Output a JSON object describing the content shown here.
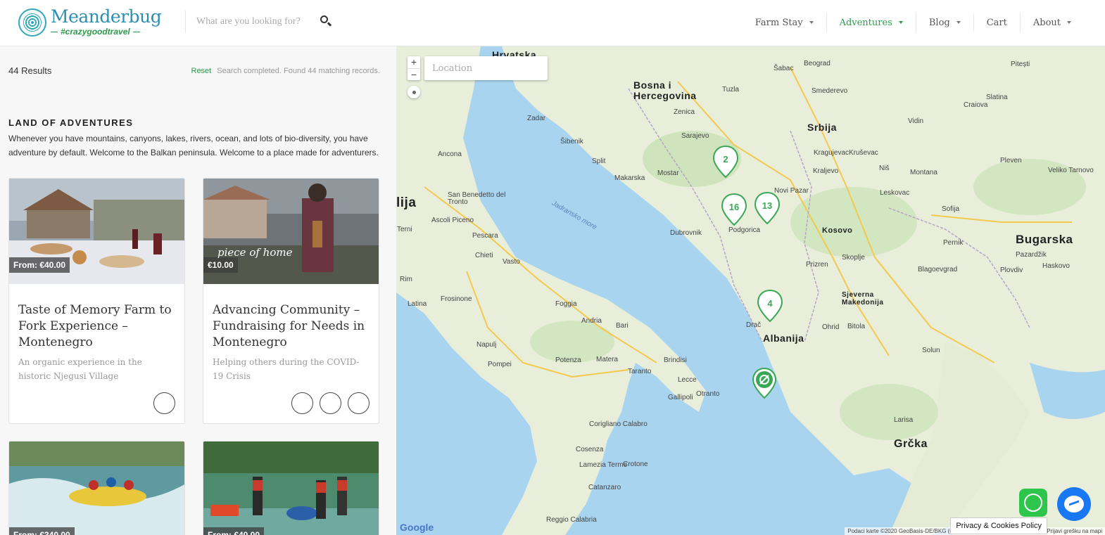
{
  "header": {
    "logo": {
      "title": "Meanderbug",
      "tagline": "#crazygoodtravel"
    },
    "search": {
      "placeholder": "What are you looking for?"
    },
    "nav": [
      {
        "label": "Farm Stay",
        "dropdown": true,
        "active": false
      },
      {
        "label": "Adventures",
        "dropdown": true,
        "active": true
      },
      {
        "label": "Blog",
        "dropdown": true,
        "active": false
      },
      {
        "label": "Cart",
        "dropdown": false,
        "active": false
      },
      {
        "label": "About",
        "dropdown": true,
        "active": false
      }
    ]
  },
  "results": {
    "count": "44 Results",
    "reset": "Reset",
    "status": "Search completed. Found 44 matching records."
  },
  "section": {
    "title": "LAND OF ADVENTURES",
    "description": "Whenever you have mountains, canyons, lakes, rivers, ocean, and lots of bio-diversity, you have adventure by default. Welcome to the Balkan peninsula. Welcome to a place made for adventurers."
  },
  "cards": [
    {
      "price": "From: €40.00",
      "title": "Taste of Memory Farm to Fork Experience – Montenegro",
      "subtitle": "An organic experience in the historic Njegusi Village",
      "icons": 1
    },
    {
      "price": "€10.00",
      "title": "Advancing Community – Fundraising for Needs in Montenegro",
      "subtitle": "Helping others during the COVID-19 Crisis",
      "image_text": "piece of home",
      "icons": 3
    },
    {
      "price": "From: €340.00",
      "title": "",
      "subtitle": "",
      "icons": 0
    },
    {
      "price": "From: €40.00",
      "title": "",
      "subtitle": "",
      "icons": 0
    }
  ],
  "map": {
    "location_placeholder": "Location",
    "zoom_in": "+",
    "zoom_out": "−",
    "clusters": [
      "2",
      "16",
      "13",
      "4"
    ],
    "countries": [
      "Hrvatska",
      "Bosna i Hercegovina",
      "Srbija",
      "Kosovo",
      "Albanija",
      "Grčka",
      "Bugarska",
      "Sjeverna Makedonija",
      "lija"
    ],
    "cities": [
      "Sarajevo",
      "Split",
      "Zadar",
      "Mostar",
      "Dubrovnik",
      "Podgorica",
      "Skoplje",
      "Sofija",
      "Plovdiv",
      "Pleven",
      "Niš",
      "Kragujevac",
      "Ancona",
      "Pescara",
      "Foggia",
      "Bari",
      "Napulj",
      "Taranto",
      "Brindisi",
      "Lecce",
      "Solun",
      "Drač",
      "Bitola",
      "Larisa",
      "Cosenza",
      "Catanzaro",
      "Reggio Calabria",
      "Rim",
      "Latina",
      "Pompei",
      "Potenza",
      "Matera",
      "Andria",
      "Terni",
      "Chieti",
      "Vasto",
      "Frosinone",
      "Ascoli Piceno",
      "San Benedetto del Tronto",
      "Šibenik",
      "Makarska",
      "Tuzla",
      "Zenica",
      "Beograd",
      "Šabac",
      "Smederevo",
      "Kruševac",
      "Kraljevo",
      "Novi Pazar",
      "Prizren",
      "Leskovac",
      "Pernik",
      "Montana",
      "Veliko Tarnovo",
      "Pazardžik",
      "Haskovo",
      "Blagoevgrad",
      "Ohrid",
      "Gallipoli",
      "Otranto",
      "Corigliano Calabro",
      "Crotone",
      "Lamezia Terme",
      "Craiova",
      "Pitești",
      "Slatina",
      "Vidin"
    ],
    "sea_label": "Jadransko more",
    "google": "Google",
    "attribution": "Podaci karte ©2020 GeoBasis-DE/BKG (©2009), Google, Inst. Geogr. Nacional  Prijavi grešku na mapi",
    "privacy": "Privacy & Cookies Policy"
  },
  "colors": {
    "accent": "#2e9a4b",
    "brand": "#2d8fb0",
    "map_water": "#a8d4f0",
    "map_land": "#e8ecd8"
  }
}
